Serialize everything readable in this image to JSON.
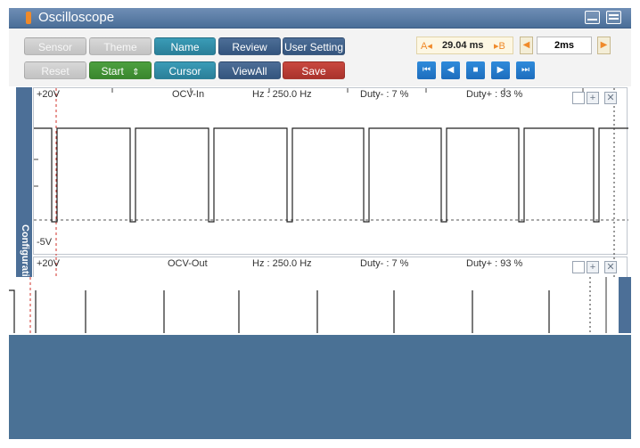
{
  "window": {
    "title": "Oscilloscope"
  },
  "toolbar": {
    "row1": {
      "sensor": "Sensor",
      "theme": "Theme",
      "name": "Name",
      "review": "Review",
      "user_setting": "User Setting"
    },
    "row2": {
      "reset": "Reset",
      "start": "Start",
      "start_spinner": "⇕",
      "cursor": "Cursor",
      "view_all": "ViewAll",
      "save": "Save"
    },
    "cursor_readout": {
      "a_marker": "A◂",
      "value": "29.04 ms",
      "b_marker": "▸B"
    },
    "timebase": {
      "value": "2ms"
    },
    "playback": {
      "first": "⏮",
      "prev": "◀",
      "stop": "■",
      "next": "▶",
      "last": "⏭"
    }
  },
  "side_panel": {
    "label": "Configurati"
  },
  "channels": [
    {
      "top_label": "+20V",
      "bottom_label": "-5V",
      "name": "OCV-In",
      "hz": "Hz : 250.0 Hz",
      "duty_minus": "Duty- : 7 %",
      "duty_plus": "Duty+ : 93 %"
    },
    {
      "top_label": "+20V",
      "name": "OCV-Out",
      "hz": "Hz : 250.0 Hz",
      "duty_minus": "Duty- : 7 %",
      "duty_plus": "Duty+ : 93 %"
    }
  ],
  "colors": {
    "title_bar": "#5a7ea8",
    "accent_blue": "#1f72c4",
    "panel_bg": "#4a7195"
  }
}
